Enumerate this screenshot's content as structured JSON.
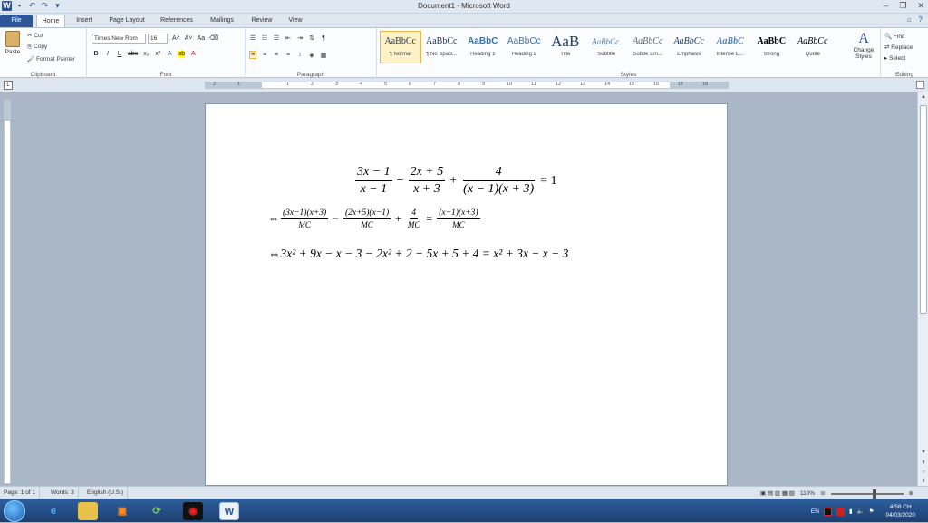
{
  "window": {
    "title": "Document1 - Microsoft Word"
  },
  "tabs": [
    {
      "label": "File"
    },
    {
      "label": "Home"
    },
    {
      "label": "Insert"
    },
    {
      "label": "Page Layout"
    },
    {
      "label": "References"
    },
    {
      "label": "Mailings"
    },
    {
      "label": "Review"
    },
    {
      "label": "View"
    }
  ],
  "ribbon": {
    "clipboard": {
      "paste": "Paste",
      "cut": "Cut",
      "copy": "Copy",
      "format_painter": "Format Painter",
      "label": "Clipboard"
    },
    "font": {
      "name": "Times New Rom",
      "size": "16",
      "label": "Font"
    },
    "paragraph": {
      "label": "Paragraph"
    },
    "styles": {
      "label": "Styles",
      "items": [
        {
          "preview": "AaBbCc",
          "name": "¶ Normal"
        },
        {
          "preview": "AaBbCc",
          "name": "¶ No Spaci..."
        },
        {
          "preview": "AaBbC",
          "name": "Heading 1"
        },
        {
          "preview": "AaBbCc",
          "name": "Heading 2"
        },
        {
          "preview": "AaB",
          "name": "Title"
        },
        {
          "preview": "AaBbCc.",
          "name": "Subtitle"
        },
        {
          "preview": "AaBbCc",
          "name": "Subtle Em..."
        },
        {
          "preview": "AaBbCc",
          "name": "Emphasis"
        },
        {
          "preview": "AaBbC",
          "name": "Intense E..."
        },
        {
          "preview": "AaBbC",
          "name": "Strong"
        },
        {
          "preview": "AaBbCc",
          "name": "Quote"
        }
      ],
      "change_styles": "Change Styles"
    },
    "editing": {
      "find": "Find",
      "replace": "Replace",
      "select": "Select",
      "label": "Editing"
    }
  },
  "document": {
    "eq1": {
      "f1n": "3x − 1",
      "f1d": "x − 1",
      "op1": "−",
      "f2n": "2x + 5",
      "f2d": "x + 3",
      "op2": "+",
      "f3n": "4",
      "f3d": "(x − 1)(x + 3)",
      "rhs": "= 1"
    },
    "eq2": {
      "arrow": "⇔",
      "f1n": "(3x−1)(x+3)",
      "f1d": "MC",
      "op1": "−",
      "f2n": "(2x+5)(x−1)",
      "f2d": "MC",
      "op2": "+",
      "f3n": "4",
      "f3d": "MC",
      "eq": "=",
      "f4n": "(x−1)(x+3)",
      "f4d": "MC"
    },
    "eq3": {
      "arrow": "⇔",
      "text": "3x² + 9x − x − 3 − 2x² + 2 − 5x + 5 + 4 = x² + 3x − x − 3"
    }
  },
  "status": {
    "page": "Page: 1 of 1",
    "words": "Words: 3",
    "language": "English (U.S.)",
    "zoom": "110%"
  },
  "taskbar": {
    "language": "EN",
    "time": "4:58 CH",
    "date": "04/03/2020"
  },
  "colors": {
    "accent": "#2b579a",
    "workspace": "#a9b7c7"
  }
}
